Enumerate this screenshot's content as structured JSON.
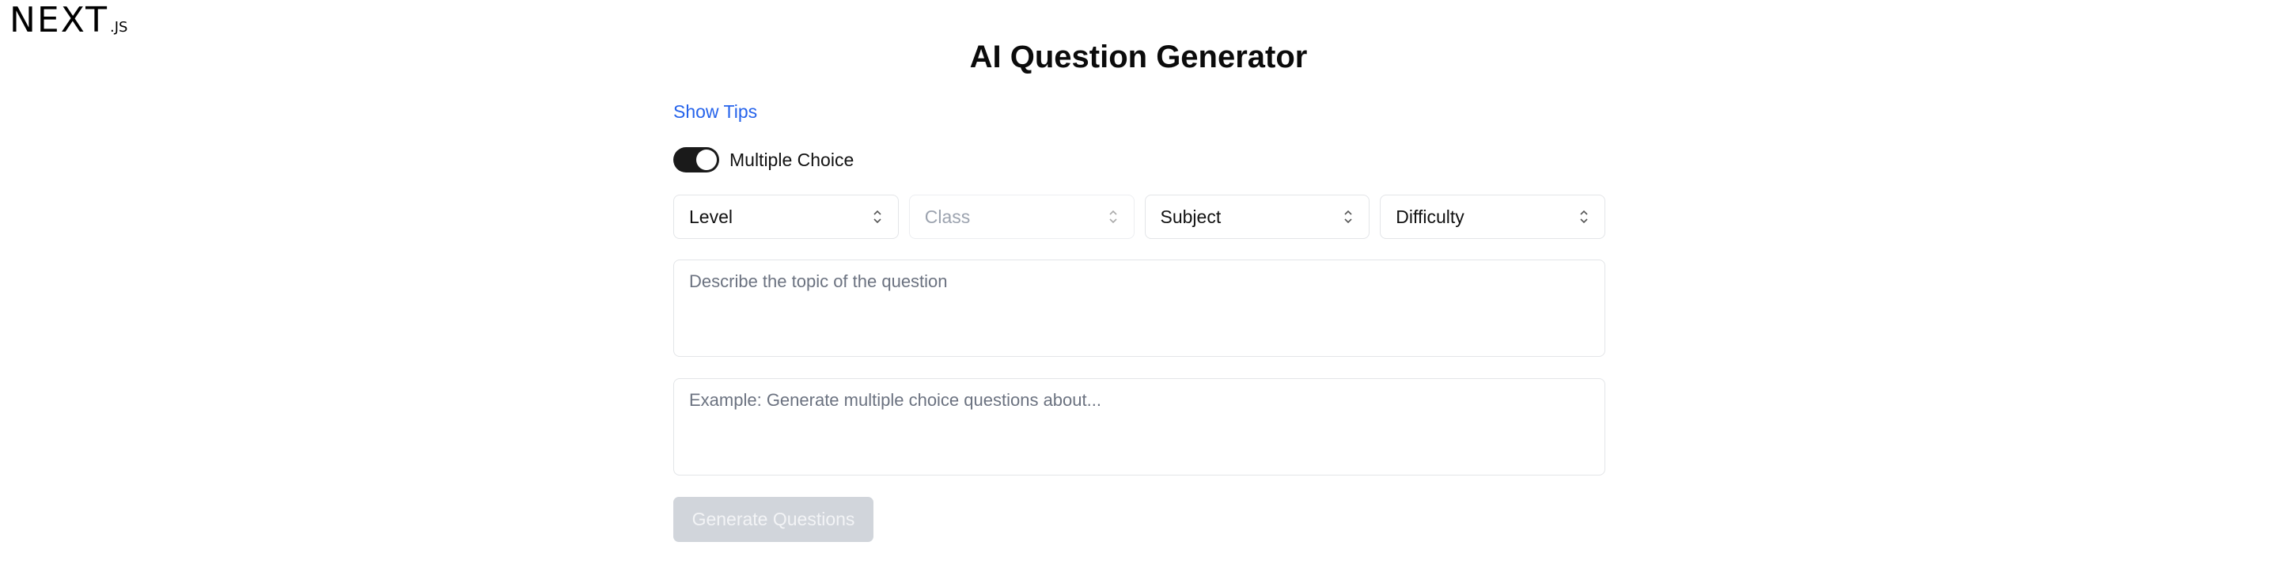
{
  "brand": {
    "logo_main": "NEXT",
    "logo_sub": ".JS"
  },
  "page": {
    "title": "AI Question Generator"
  },
  "tips": {
    "label": "Show Tips"
  },
  "toggle": {
    "label": "Multiple Choice",
    "checked": true
  },
  "selects": [
    {
      "label": "Level",
      "disabled": false
    },
    {
      "label": "Class",
      "disabled": true
    },
    {
      "label": "Subject",
      "disabled": false
    },
    {
      "label": "Difficulty",
      "disabled": false
    }
  ],
  "topic_input": {
    "value": "",
    "placeholder": "Describe the topic of the question"
  },
  "prompt_input": {
    "value": "",
    "placeholder": "Example: Generate multiple choice questions about..."
  },
  "generate_button": {
    "label": "Generate Questions",
    "disabled": true
  },
  "colors": {
    "link": "#2563eb",
    "toggle_on": "#1a1a1a",
    "button_disabled_bg": "#d1d5db"
  }
}
